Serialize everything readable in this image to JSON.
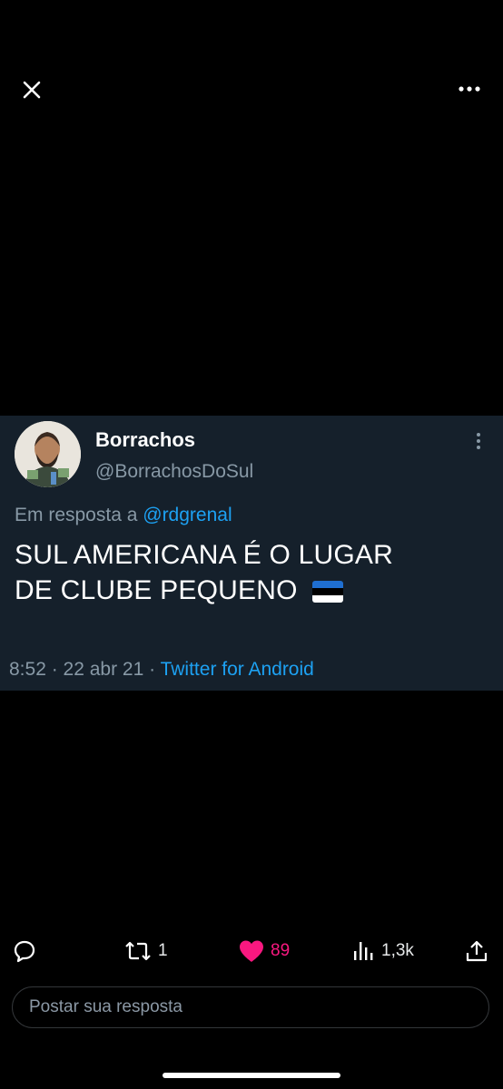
{
  "top_bar": {
    "close_icon": "close-icon",
    "more_icon": "more-horizontal-icon"
  },
  "tweet": {
    "display_name": "Borrachos",
    "handle": "@BorrachosDoSul",
    "reply_prefix": "Em resposta a",
    "reply_to": "@rdgrenal",
    "text_line1": "SUL AMERICANA É O LUGAR",
    "text_line2": "DE CLUBE PEQUENO",
    "flag_colors": [
      "#1f6fd1",
      "#000000",
      "#ffffff"
    ],
    "time": "8:52",
    "date": "22 abr  21",
    "source": "Twitter for Android"
  },
  "actions": {
    "reply_icon": "comment-icon",
    "retweet_count": "1",
    "like_count": "89",
    "like_color": "#f91880",
    "views_count": "1,3k",
    "share_icon": "share-icon"
  },
  "reply_input": {
    "placeholder": "Postar sua resposta"
  }
}
